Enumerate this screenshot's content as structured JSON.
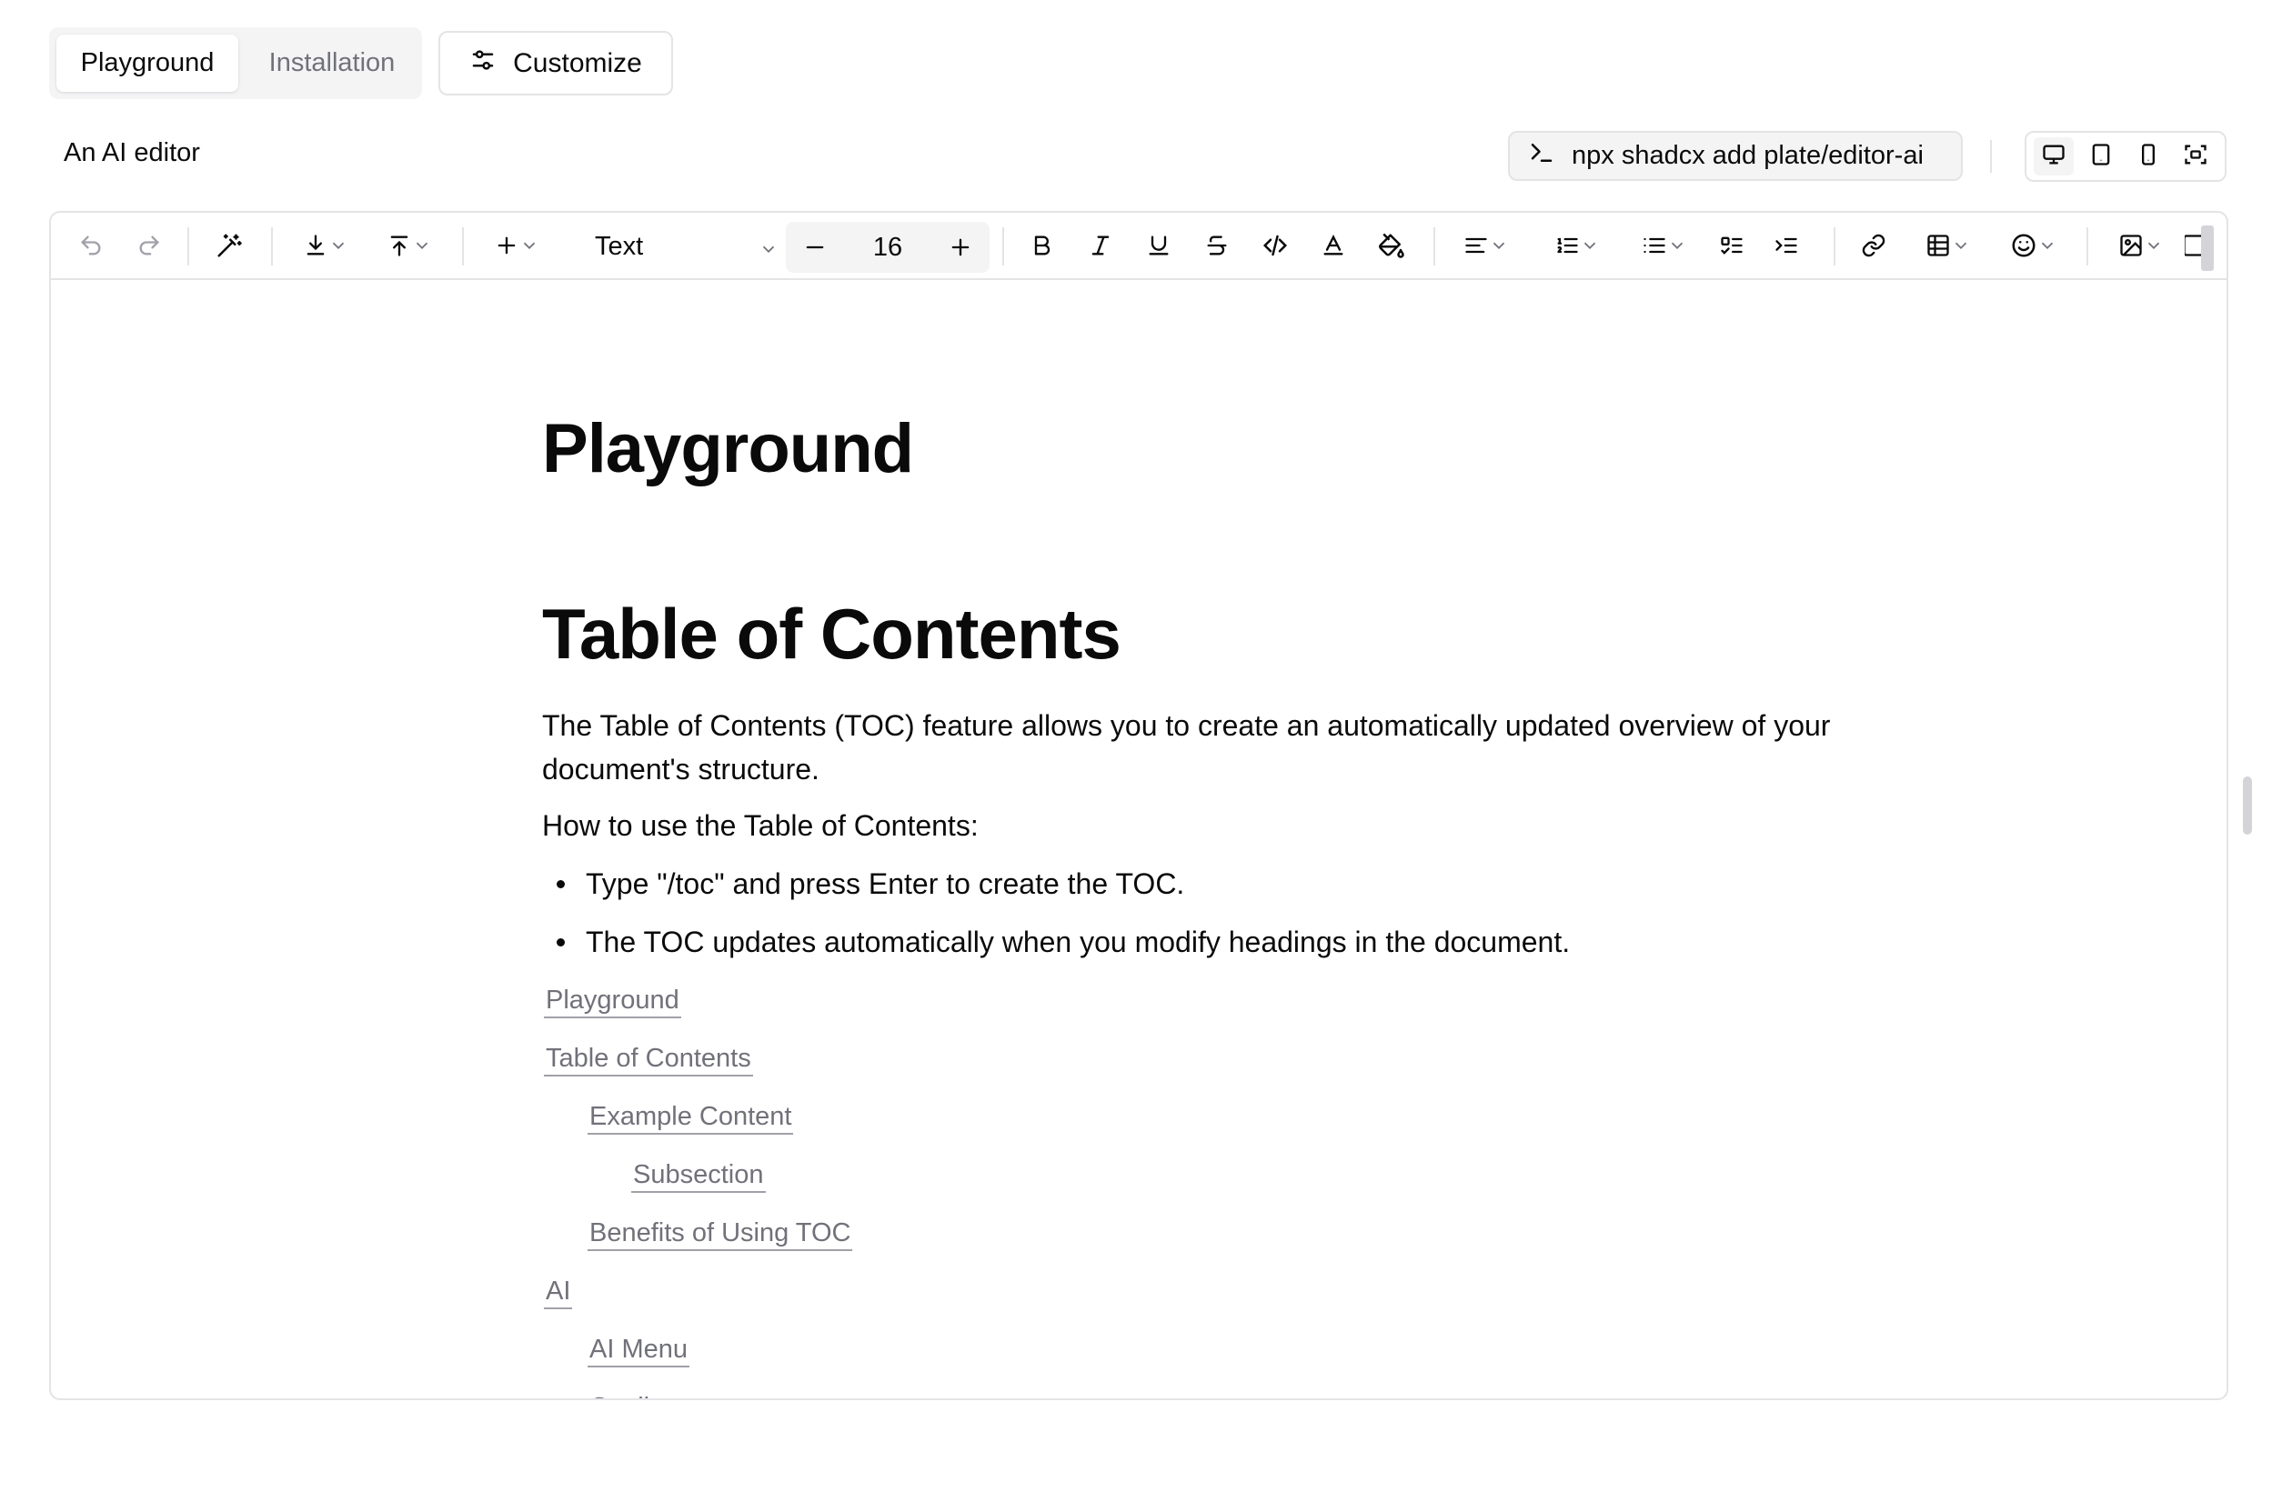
{
  "tabs": {
    "playground": "Playground",
    "installation": "Installation"
  },
  "customize_label": "Customize",
  "subtitle": "An AI editor",
  "command": "npx shadcx add plate/editor-ai",
  "toolbar": {
    "block_type": "Text",
    "font_size": "16",
    "icons": [
      "undo-icon",
      "redo-icon",
      "ai-wand-icon",
      "import-icon",
      "export-icon",
      "insert-icon",
      "decrease-font-icon",
      "increase-font-icon",
      "bold-icon",
      "italic-icon",
      "underline-icon",
      "strikethrough-icon",
      "code-icon",
      "text-color-icon",
      "highlight-icon",
      "align-icon",
      "numbered-list-icon",
      "bulleted-list-icon",
      "todo-list-icon",
      "indent-list-icon",
      "link-icon",
      "table-icon",
      "emoji-icon",
      "image-icon"
    ]
  },
  "document": {
    "title": "Playground",
    "heading": "Table of Contents",
    "paragraph1": "The Table of Contents (TOC) feature allows you to create an automatically updated overview of your document's structure.",
    "paragraph2": "How to use the Table of Contents:",
    "bullets": [
      "Type \"/toc\" and press Enter to create the TOC.",
      "The TOC updates automatically when you modify headings in the document."
    ],
    "toc": [
      {
        "label": "Playground",
        "level": 1
      },
      {
        "label": "Table of Contents",
        "level": 1
      },
      {
        "label": "Example Content",
        "level": 2
      },
      {
        "label": "Subsection",
        "level": 3
      },
      {
        "label": "Benefits of Using TOC",
        "level": 2
      },
      {
        "label": "AI",
        "level": 1
      },
      {
        "label": "AI Menu",
        "level": 2
      },
      {
        "label": "Copilot",
        "level": 2
      }
    ]
  }
}
